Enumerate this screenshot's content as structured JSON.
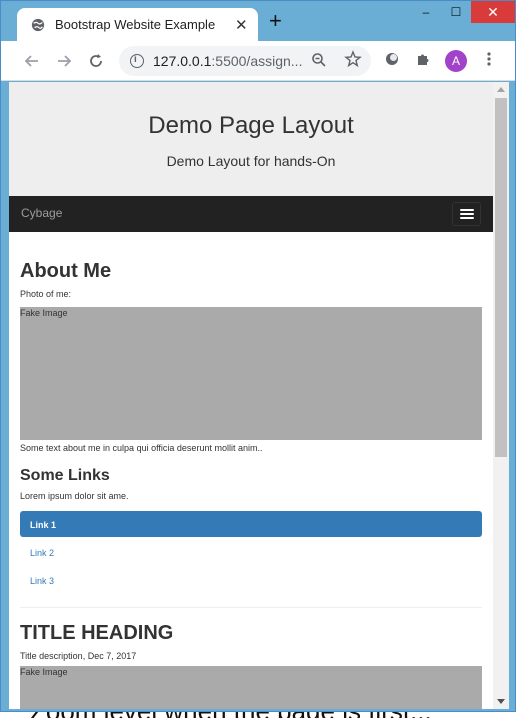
{
  "browser": {
    "tab_title": "Bootstrap Website Example",
    "tab_close": "✕",
    "new_tab": "+",
    "url_host": "127.0.0.1",
    "url_rest": ":5500/assign...",
    "avatar_letter": "A",
    "window_controls": {
      "minimize": "–",
      "maximize": "☐",
      "close": "✕"
    },
    "icons": [
      "globe-icon",
      "back-arrow-icon",
      "forward-arrow-icon",
      "reload-icon",
      "info-icon",
      "zoom-out-icon",
      "star-icon",
      "extension-circle-icon",
      "puzzle-icon",
      "more-vertical-icon",
      "hamburger-menu-icon"
    ]
  },
  "page": {
    "jumbotron": {
      "title": "Demo Page Layout",
      "subtitle": "Demo Layout for hands-On"
    },
    "navbar": {
      "brand": "Cybage"
    },
    "about": {
      "heading": "About Me",
      "photo_label": "Photo of me:",
      "image_label": "Fake Image",
      "text": "Some text about me in culpa qui officia deserunt mollit anim.."
    },
    "links": {
      "heading": "Some Links",
      "text": "Lorem ipsum dolor sit ame.",
      "items": [
        {
          "label": "Link 1",
          "active": true
        },
        {
          "label": "Link 2",
          "active": false
        },
        {
          "label": "Link 3",
          "active": false
        }
      ]
    },
    "post": {
      "heading": "TITLE HEADING",
      "description": "Title description, Dec 7, 2017",
      "image_label": "Fake Image"
    }
  },
  "desktop_text": "Zoom level when the page is first..."
}
